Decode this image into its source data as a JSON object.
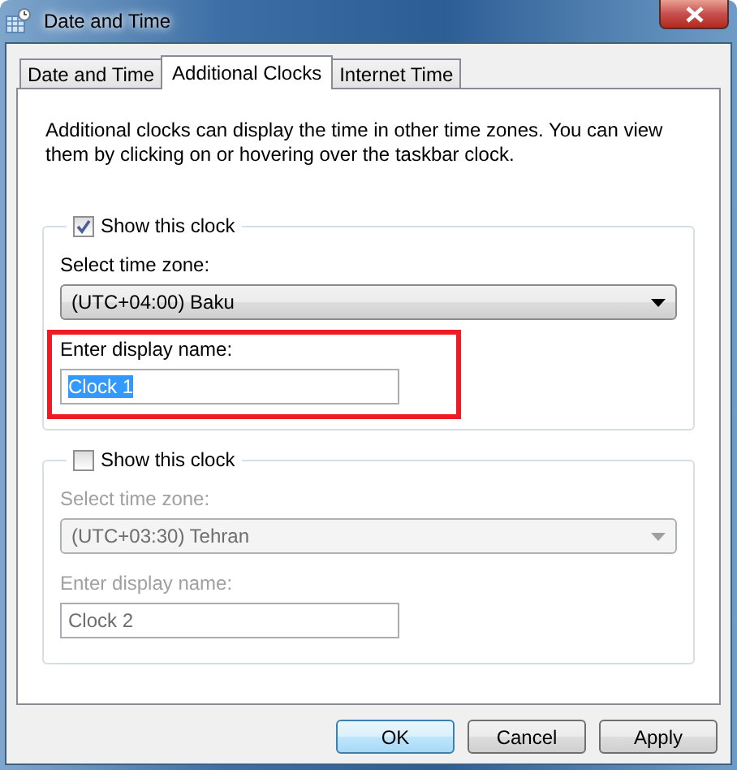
{
  "window": {
    "title": "Date and Time"
  },
  "tabs": [
    {
      "label": "Date and Time",
      "selected": false
    },
    {
      "label": "Additional Clocks",
      "selected": true
    },
    {
      "label": "Internet Time",
      "selected": false
    }
  ],
  "intro": "Additional clocks can display the time in other time zones. You can view them by clicking on or hovering over the taskbar clock.",
  "clocks": [
    {
      "show_label": "Show this clock",
      "checked": true,
      "zone_label": "Select time zone:",
      "time_zone": "(UTC+04:00) Baku",
      "name_label": "Enter display name:",
      "display_name": "Clock 1",
      "text_selected": true,
      "highlighted": true
    },
    {
      "show_label": "Show this clock",
      "checked": false,
      "zone_label": "Select time zone:",
      "time_zone": "(UTC+03:30) Tehran",
      "name_label": "Enter display name:",
      "display_name": "Clock 2",
      "text_selected": false,
      "highlighted": false
    }
  ],
  "buttons": [
    {
      "label": "OK",
      "default": true
    },
    {
      "label": "Cancel",
      "default": false
    },
    {
      "label": "Apply",
      "default": false
    }
  ]
}
